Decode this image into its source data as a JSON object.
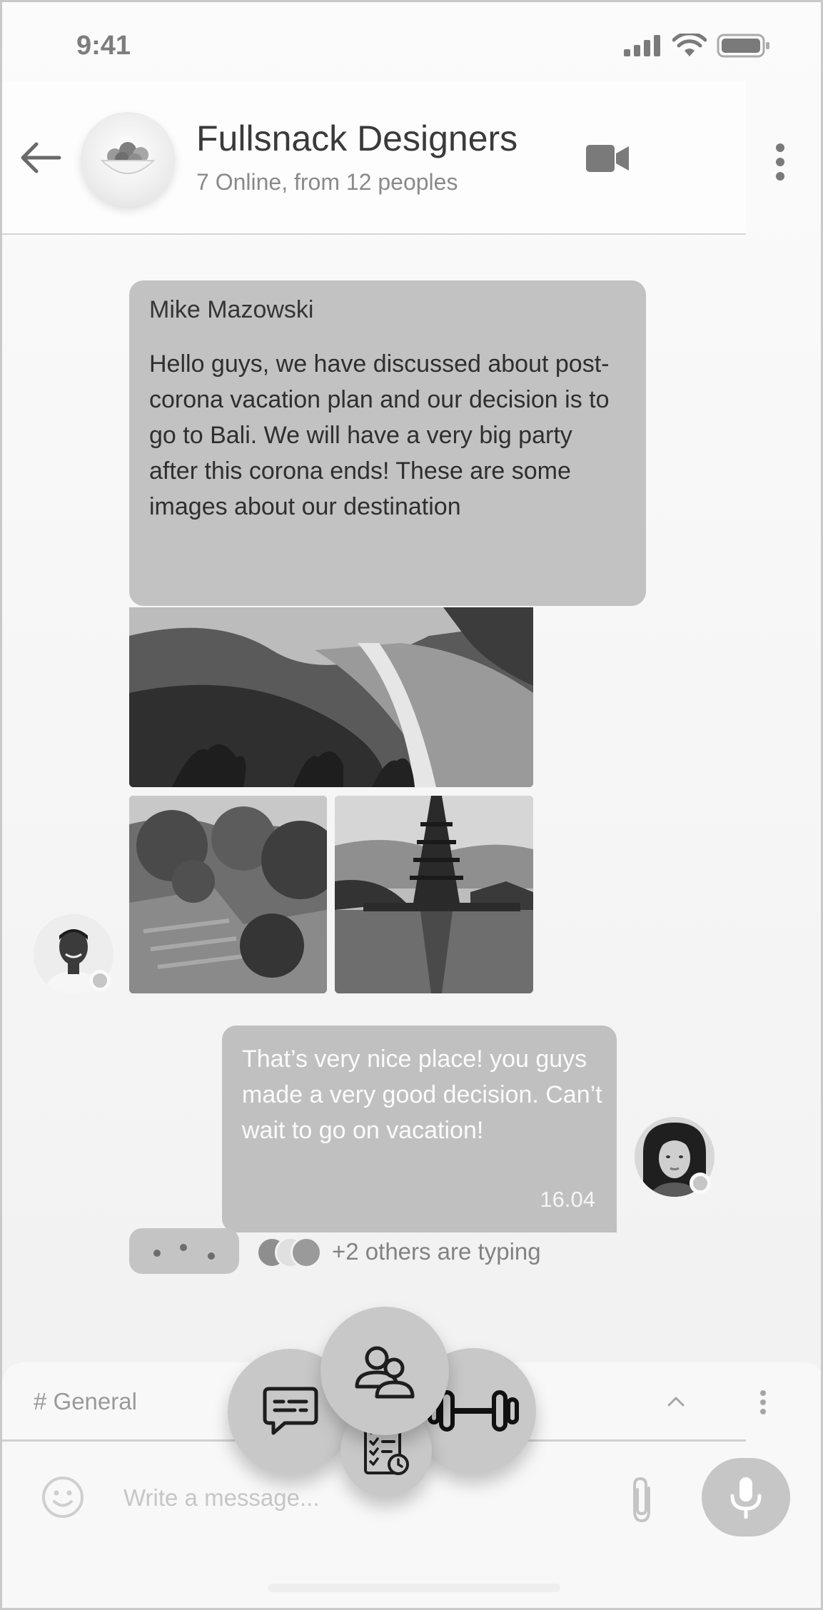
{
  "status_bar": {
    "time": "9:41"
  },
  "header": {
    "group_name": "Fullsnack Designers",
    "group_status": "7 Online, from 12 peoples"
  },
  "messages": [
    {
      "author": "Mike Mazowski",
      "text": "Hello guys, we have discussed about post-corona vacation plan and our decision is to go to Bali. We will have a very big party after this corona ends! These are some images about our destination"
    },
    {
      "text": "That’s very nice place! you guys made a very good decision. Can’t wait to go on vacation!",
      "time": "16.04"
    }
  ],
  "typing": {
    "text": "+2 others are typing"
  },
  "composer": {
    "channel": "# General",
    "placeholder": "Write a message..."
  },
  "icons": {
    "status": [
      "signal-icon",
      "wifi-icon",
      "battery-icon"
    ],
    "header": [
      "back-arrow-icon",
      "fruit-bowl-icon",
      "video-camera-icon",
      "more-vertical-icon"
    ],
    "composer": [
      "emoji-icon",
      "paperclip-icon",
      "microphone-icon",
      "chevron-up-icon",
      "more-vertical-icon"
    ],
    "fab_menu": [
      "chat-icon",
      "people-icon",
      "checklist-icon",
      "dumbbell-icon"
    ]
  },
  "colors": {
    "bubble": "#c2c2c2",
    "fab": "#c8c8c8",
    "muted_text": "#8a8a8a"
  }
}
